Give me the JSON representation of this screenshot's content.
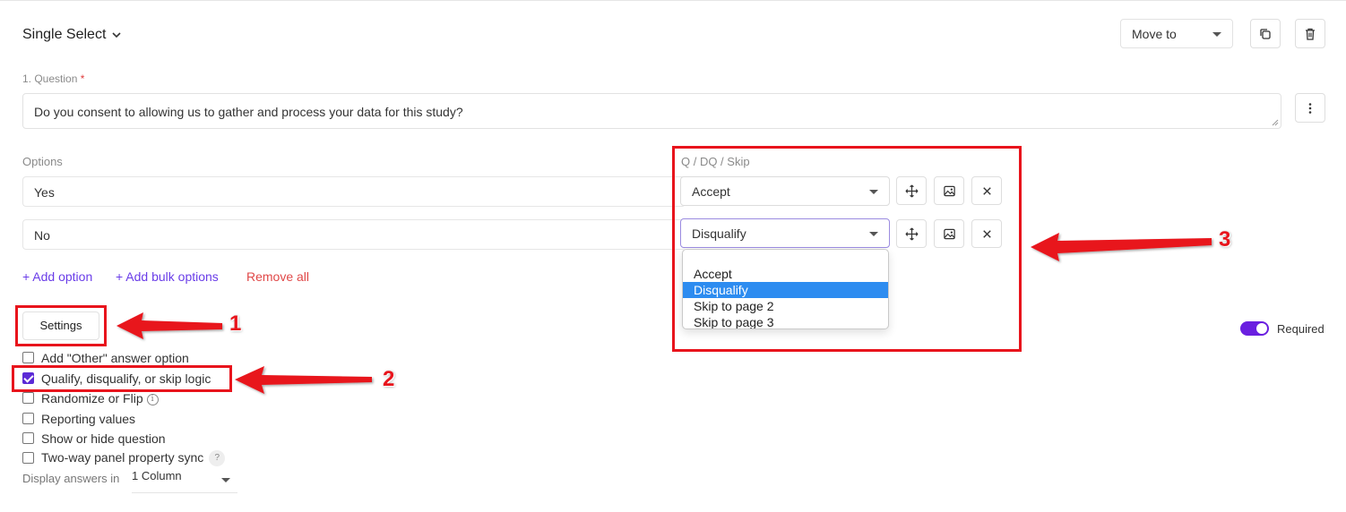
{
  "header": {
    "question_type": "Single Select",
    "move_to": "Move to"
  },
  "question": {
    "label": "1. Question",
    "required_mark": "*",
    "text": "Do you consent to allowing us to gather and process your data for this study?"
  },
  "options": {
    "label": "Options",
    "items": [
      {
        "text": "Yes",
        "logic": "Accept"
      },
      {
        "text": "No",
        "logic": "Disqualify"
      }
    ],
    "logic_label": "Q / DQ / Skip"
  },
  "logic_dropdown": {
    "options": [
      "Accept",
      "Disqualify",
      "Skip to page 2",
      "Skip to page 3"
    ],
    "selected": "Disqualify"
  },
  "actions": {
    "add_option": "+ Add option",
    "add_bulk": "+ Add bulk options",
    "remove_all": "Remove all"
  },
  "settings": {
    "button": "Settings",
    "required_label": "Required",
    "checkboxes": [
      {
        "label": "Add \"Other\" answer option",
        "checked": false
      },
      {
        "label": "Qualify, disqualify, or skip logic",
        "checked": true
      },
      {
        "label": "Randomize or Flip",
        "checked": false
      },
      {
        "label": "Reporting values",
        "checked": false
      },
      {
        "label": "Show or hide question",
        "checked": false
      },
      {
        "label": "Two-way panel property sync",
        "checked": false
      }
    ],
    "display_label": "Display answers in",
    "display_value": "1 Column"
  },
  "annotations": {
    "n1": "1",
    "n2": "2",
    "n3": "3"
  },
  "colors": {
    "accent": "#6a1fe0",
    "annotation_red": "#e8141c",
    "selected_option": "#2d8cf0"
  }
}
